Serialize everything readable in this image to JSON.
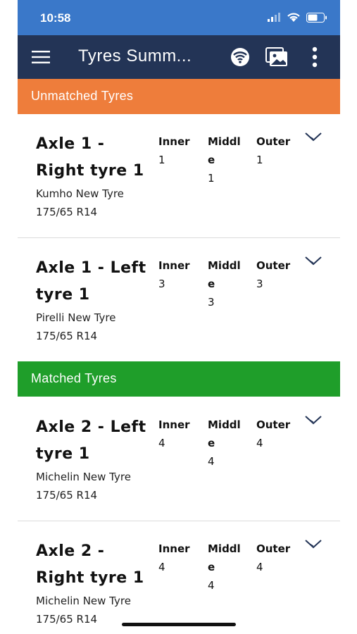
{
  "status_bar": {
    "time": "10:58"
  },
  "app_bar": {
    "title": "Tyres Summ..."
  },
  "sections": {
    "unmatched": {
      "label": "Unmatched Tyres",
      "color": "#ee7d3b"
    },
    "matched": {
      "label": "Matched Tyres",
      "color": "#1f9e2a"
    }
  },
  "columns": {
    "inner": "Inner",
    "middle": "Middle",
    "outer": "Outer"
  },
  "unmatched_tyres": [
    {
      "name": "Axle 1 - Right tyre 1",
      "brand": "Kumho New Tyre",
      "size": "175/65 R14",
      "inner": "1",
      "middle": "1",
      "outer": "1"
    },
    {
      "name": "Axle 1 - Left tyre 1",
      "brand": "Pirelli New Tyre",
      "size": "175/65 R14",
      "inner": "3",
      "middle": "3",
      "outer": "3"
    }
  ],
  "matched_tyres": [
    {
      "name": "Axle 2 - Left tyre 1",
      "brand": "Michelin New Tyre",
      "size": "175/65 R14",
      "inner": "4",
      "middle": "4",
      "outer": "4"
    },
    {
      "name": "Axle 2 - Right tyre 1",
      "brand": "Michelin New Tyre",
      "size": "175/65 R14",
      "inner": "4",
      "middle": "4",
      "outer": "4"
    }
  ],
  "colors": {
    "status_bar": "#3a78c9",
    "app_bar": "#233456"
  }
}
